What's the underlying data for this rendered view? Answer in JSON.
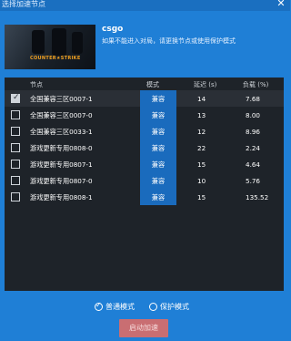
{
  "window": {
    "title": "选择加速节点"
  },
  "game": {
    "name": "csgo",
    "logo_text": "COUNTER★STRIKE",
    "hint": "如果不能进入对局，请更换节点或使用保护模式"
  },
  "table": {
    "headers": {
      "node": "节点",
      "mode": "模式",
      "latency": "延迟 (s)",
      "load": "负载 (%)"
    },
    "rows": [
      {
        "checked": true,
        "node": "全国兼容三区0007-1",
        "mode": "兼容",
        "latency": "14",
        "load": "7.68"
      },
      {
        "checked": false,
        "node": "全国兼容三区0007-0",
        "mode": "兼容",
        "latency": "13",
        "load": "8.00"
      },
      {
        "checked": false,
        "node": "全国兼容三区0033-1",
        "mode": "兼容",
        "latency": "12",
        "load": "8.96"
      },
      {
        "checked": false,
        "node": "游戏更新专用0808-0",
        "mode": "兼容",
        "latency": "22",
        "load": "2.24"
      },
      {
        "checked": false,
        "node": "游戏更新专用0807-1",
        "mode": "兼容",
        "latency": "15",
        "load": "4.64"
      },
      {
        "checked": false,
        "node": "游戏更新专用0807-0",
        "mode": "兼容",
        "latency": "10",
        "load": "5.76"
      },
      {
        "checked": false,
        "node": "游戏更新专用0808-1",
        "mode": "兼容",
        "latency": "15",
        "load": "135.52"
      }
    ]
  },
  "modes": {
    "normal": "普通模式",
    "protect": "保护模式",
    "selected": "normal"
  },
  "start_button": "启动加速",
  "colors": {
    "background": "#1f7fd6",
    "panel": "#1e2329",
    "mode_pill": "#1a6bbd",
    "start_button": "#c96e72"
  }
}
